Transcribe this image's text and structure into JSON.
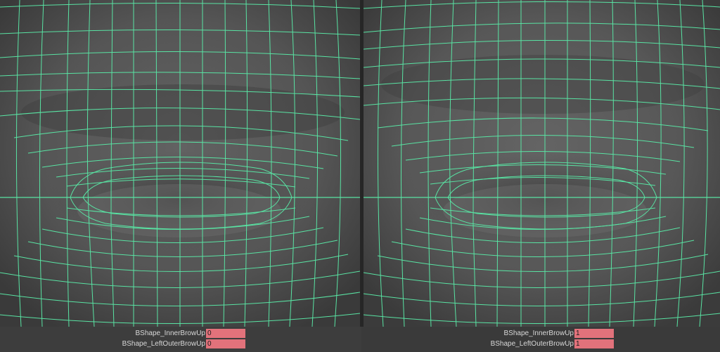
{
  "viewports": [
    {
      "attributes": [
        {
          "name": "BShape_InnerBrowUp",
          "value": "0"
        },
        {
          "name": "BShape_LeftOuterBrowUp",
          "value": "0"
        }
      ]
    },
    {
      "attributes": [
        {
          "name": "BShape_InnerBrowUp",
          "value": "1"
        },
        {
          "name": "BShape_LeftOuterBrowUp",
          "value": "1"
        }
      ]
    }
  ],
  "colors": {
    "wire": "#59e3a3",
    "mesh_base": "#5a5a5a",
    "field_highlight": "#e2727b",
    "channel_bg": "#3d3d3d"
  }
}
